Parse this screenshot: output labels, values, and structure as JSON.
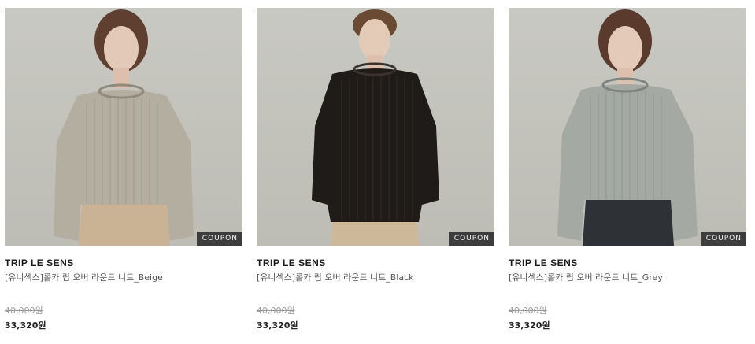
{
  "products": [
    {
      "brand": "TRIP LE SENS",
      "name": "[유니섹스]롤카 립 오버 라운드 니트_Beige",
      "original_price": "40,000원",
      "sale_price": "33,320원",
      "badge": "COUPON",
      "sweater_color": "#b3ae9f",
      "pants_color": "#c9b394",
      "hair_color": "#5e3f30"
    },
    {
      "brand": "TRIP LE SENS",
      "name": "[유니섹스]롤카 립 오버 라운드 니트_Black",
      "original_price": "40,000원",
      "sale_price": "33,320원",
      "badge": "COUPON",
      "sweater_color": "#1f1b18",
      "pants_color": "#cdb89a",
      "hair_color": "#6b4a33"
    },
    {
      "brand": "TRIP LE SENS",
      "name": "[유니섹스]롤카 립 오버 라운드 니트_Grey",
      "original_price": "40,000원",
      "sale_price": "33,320원",
      "badge": "COUPON",
      "sweater_color": "#a4a9a4",
      "pants_color": "#2e3236",
      "hair_color": "#5a3a2c"
    }
  ]
}
